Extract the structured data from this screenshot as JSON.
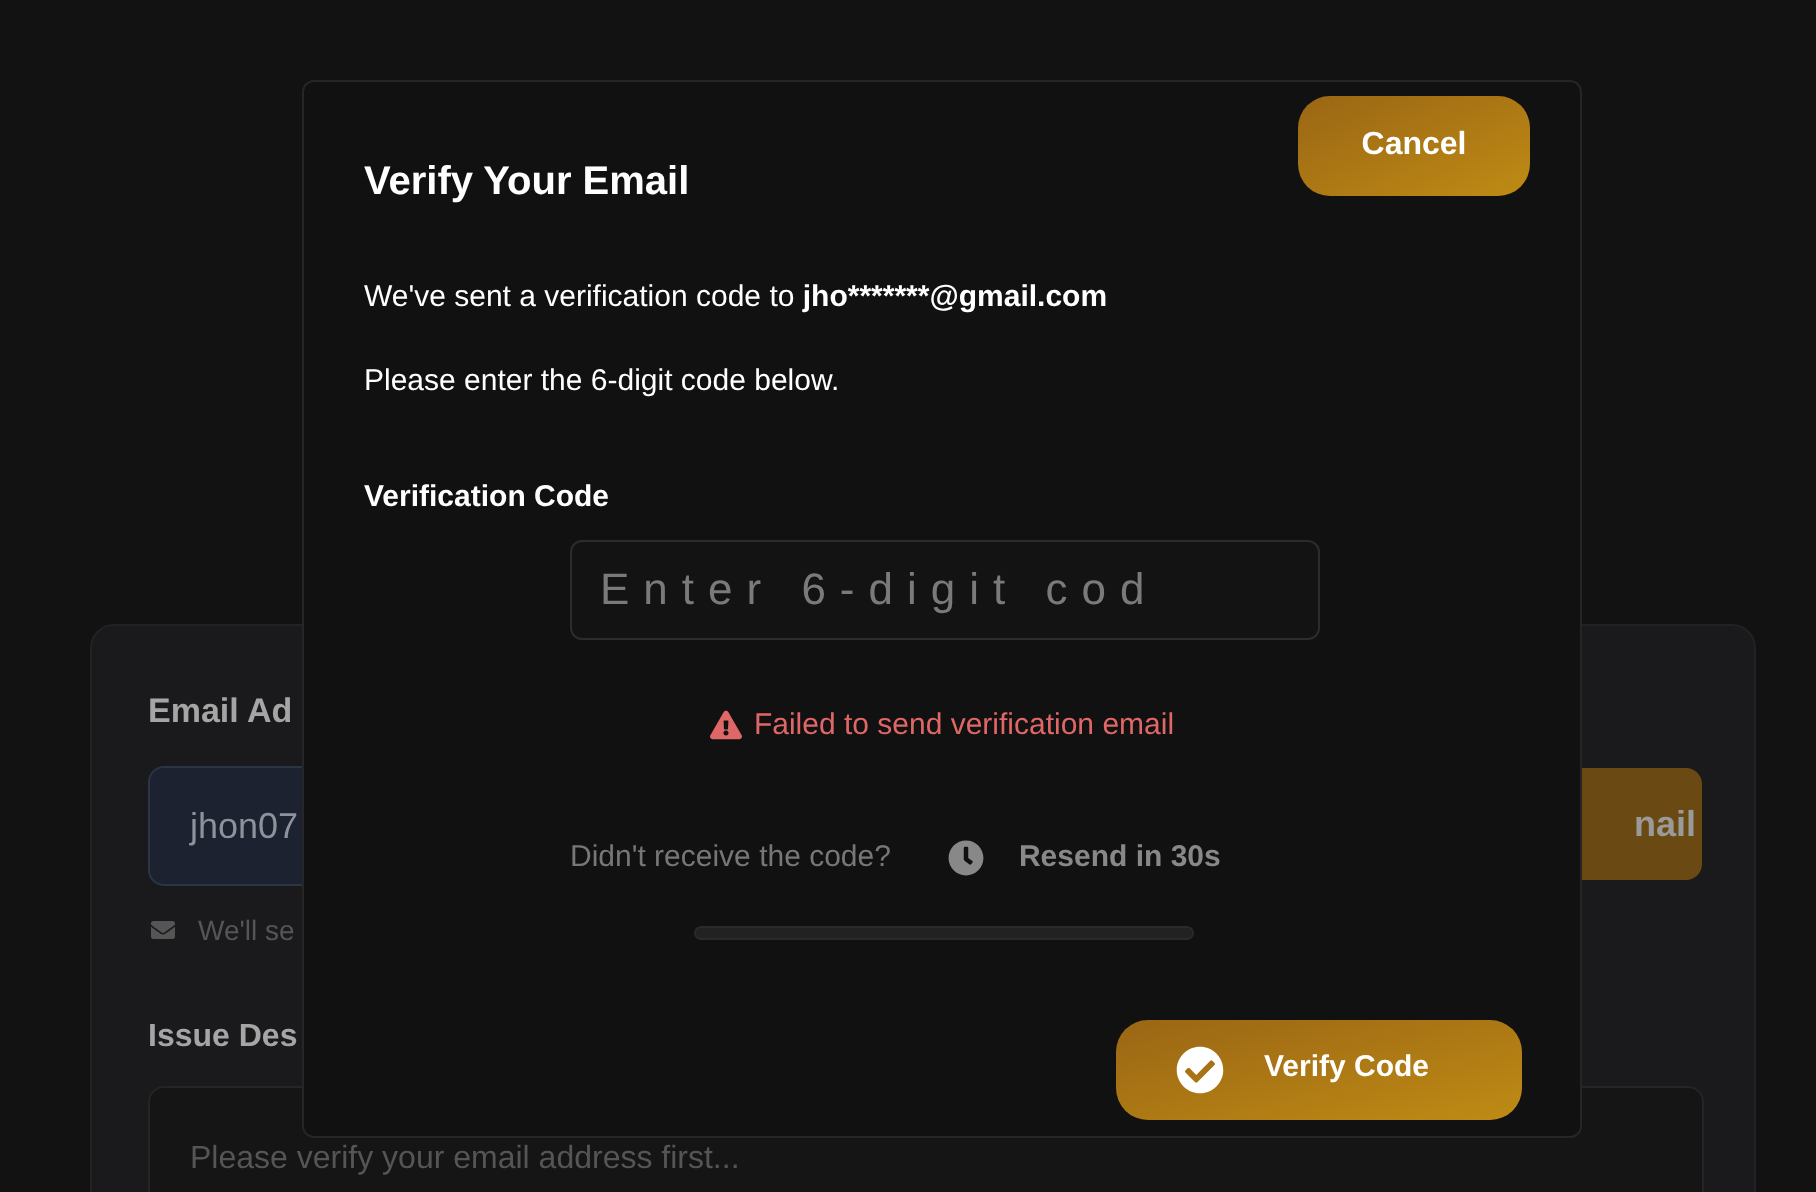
{
  "background_form": {
    "email_label": "Email Ad",
    "email_value": "jhon07",
    "send_button": "nail",
    "hint": "We'll se",
    "issue_label": "Issue Des",
    "issue_placeholder": "Please verify your email address first..."
  },
  "dialog": {
    "title": "Verify Your Email",
    "cancel": "Cancel",
    "message": "We've sent a verification code to",
    "masked_email": "jho*******@gmail.com",
    "instruction": "Please enter the 6-digit code below.",
    "code_label": "Verification Code",
    "code_placeholder": "Enter 6-digit cod",
    "error": "Failed to send verification email",
    "resend_prompt": "Didn't receive the code?",
    "resend_timer": "Resend in 30s",
    "verify": "Verify Code"
  }
}
